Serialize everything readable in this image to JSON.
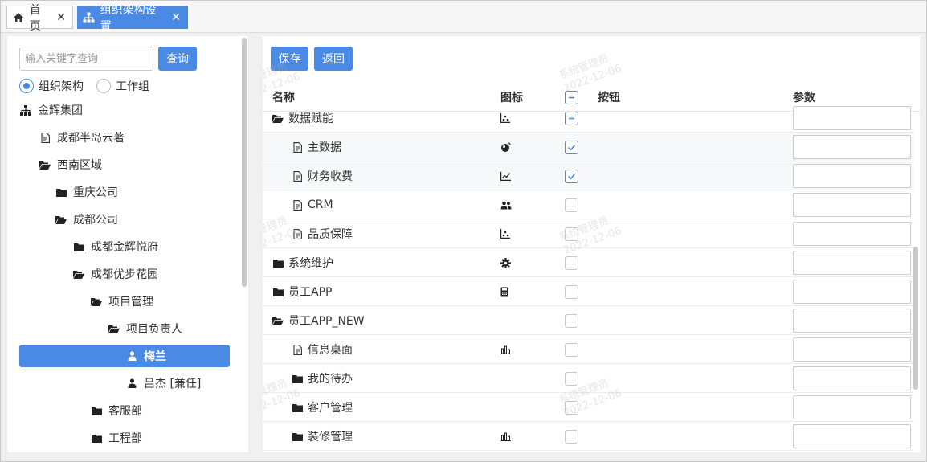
{
  "tabs": [
    {
      "label": "首页",
      "icon": "home-icon"
    },
    {
      "label": "组织架构设置",
      "icon": "org-chart-icon"
    }
  ],
  "left": {
    "search_placeholder": "输入关键字查询",
    "query_label": "查询",
    "radio_org": "组织架构",
    "radio_group": "工作组",
    "tree": [
      {
        "label": "金辉集团",
        "icon": "org-chart-icon"
      },
      {
        "label": "成都半岛云著",
        "icon": "document-icon"
      },
      {
        "label": "西南区域",
        "icon": "folder-open-icon"
      },
      {
        "label": "重庆公司",
        "icon": "folder-icon"
      },
      {
        "label": "成都公司",
        "icon": "folder-open-icon"
      },
      {
        "label": "成都金辉悦府",
        "icon": "folder-icon"
      },
      {
        "label": "成都优步花园",
        "icon": "folder-open-icon"
      },
      {
        "label": "项目管理",
        "icon": "folder-open-icon"
      },
      {
        "label": "项目负责人",
        "icon": "folder-open-icon"
      },
      {
        "label": "梅兰",
        "icon": "user-icon"
      },
      {
        "label": "吕杰 [兼任]",
        "icon": "user-icon"
      },
      {
        "label": "客服部",
        "icon": "folder-icon"
      },
      {
        "label": "工程部",
        "icon": "folder-icon"
      }
    ]
  },
  "right": {
    "save_label": "保存",
    "back_label": "返回",
    "headers": {
      "name": "名称",
      "icon": "图标",
      "button": "按钮",
      "param": "参数"
    },
    "rows": [
      {
        "name": "数据赋能",
        "type": "folder-open-icon",
        "icon": "scatter-icon",
        "check": "partial"
      },
      {
        "name": "主数据",
        "type": "document-icon",
        "icon": "globe-icon",
        "check": "checked"
      },
      {
        "name": "财务收费",
        "type": "document-icon",
        "icon": "line-chart-icon",
        "check": "checked"
      },
      {
        "name": "CRM",
        "type": "document-icon",
        "icon": "users-icon",
        "check": "unchecked"
      },
      {
        "name": "品质保障",
        "type": "document-icon",
        "icon": "scatter-icon",
        "check": "unchecked"
      },
      {
        "name": "系统维护",
        "type": "folder-icon",
        "icon": "gear-icon",
        "check": "unchecked"
      },
      {
        "name": "员工APP",
        "type": "folder-icon",
        "icon": "calculator-icon",
        "check": "unchecked"
      },
      {
        "name": "员工APP_NEW",
        "type": "folder-open-icon",
        "icon": "",
        "check": "unchecked"
      },
      {
        "name": "信息桌面",
        "type": "document-icon",
        "icon": "bar-chart-icon",
        "check": "unchecked"
      },
      {
        "name": "我的待办",
        "type": "folder-icon",
        "icon": "",
        "check": "unchecked"
      },
      {
        "name": "客户管理",
        "type": "folder-icon",
        "icon": "",
        "check": "unchecked"
      },
      {
        "name": "装修管理",
        "type": "folder-icon",
        "icon": "bar-chart-icon",
        "check": "unchecked"
      }
    ]
  },
  "watermark": {
    "line1": "系统管理员",
    "line2": "2022-12-06"
  },
  "colors": {
    "accent": "#4a8ae4"
  }
}
